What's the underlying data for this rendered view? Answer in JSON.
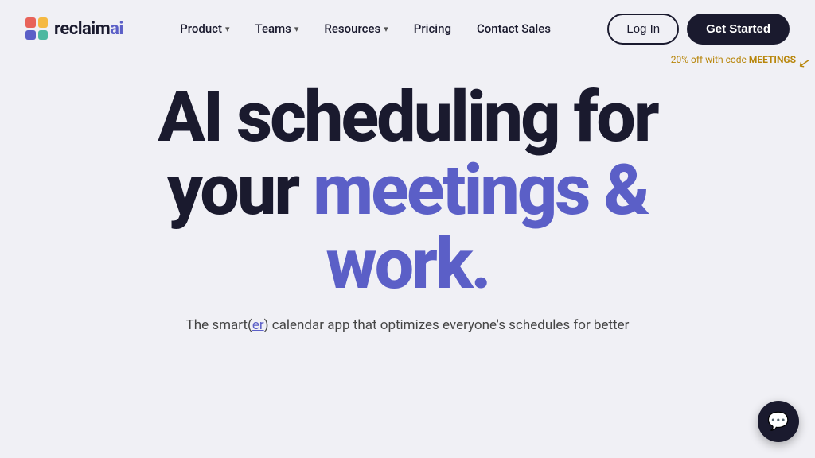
{
  "logo": {
    "text_reclaim": "reclaim",
    "text_ai": "ai",
    "dots": [
      {
        "color": "#e8635a"
      },
      {
        "color": "#f5b942"
      },
      {
        "color": "#5b5fc7"
      },
      {
        "color": "#4db8a0"
      }
    ]
  },
  "nav": {
    "items": [
      {
        "label": "Product",
        "has_dropdown": true
      },
      {
        "label": "Teams",
        "has_dropdown": true
      },
      {
        "label": "Resources",
        "has_dropdown": true
      },
      {
        "label": "Pricing",
        "has_dropdown": false
      },
      {
        "label": "Contact Sales",
        "has_dropdown": false
      }
    ]
  },
  "actions": {
    "login_label": "Log In",
    "cta_label": "Get Started"
  },
  "promo": {
    "text": "20% off with code",
    "code": "MEETINGS"
  },
  "hero": {
    "line1": "AI scheduling for",
    "line2_black": "your",
    "line2_accent": "meetings &",
    "line3": "work.",
    "subtext_prefix": "The smart(",
    "subtext_link": "er",
    "subtext_suffix": ") calendar app that optimizes everyone's schedules for better"
  }
}
